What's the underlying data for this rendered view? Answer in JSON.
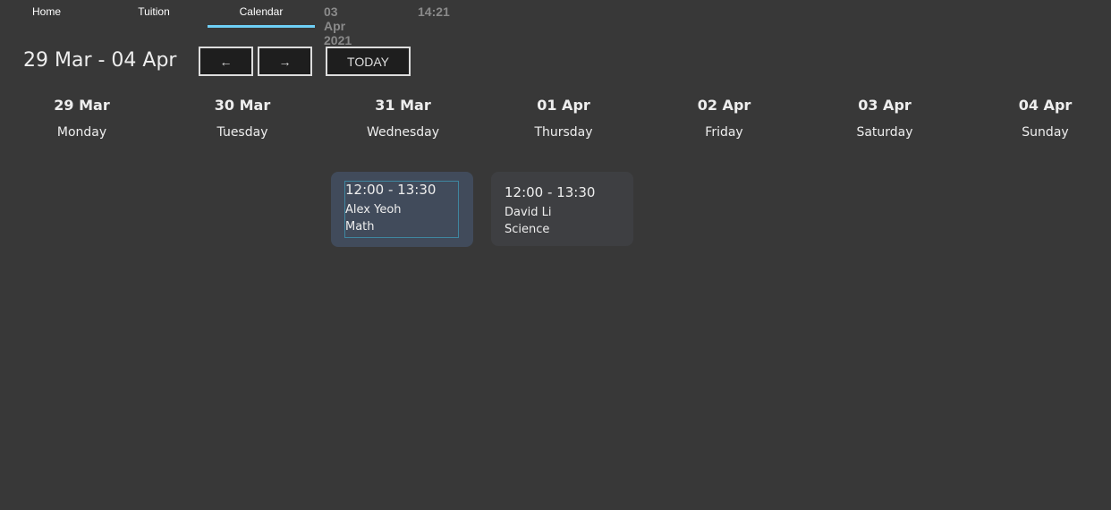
{
  "nav": {
    "tabs": [
      {
        "label": "Home"
      },
      {
        "label": "Tuition"
      },
      {
        "label": "Calendar"
      }
    ],
    "date": "03 Apr 2021",
    "time": "14:21"
  },
  "header": {
    "range": "29 Mar - 04 Apr",
    "prev": "←",
    "next": "→",
    "today": "TODAY"
  },
  "days": [
    {
      "date": "29 Mar",
      "dow": "Monday"
    },
    {
      "date": "30 Mar",
      "dow": "Tuesday"
    },
    {
      "date": "31 Mar",
      "dow": "Wednesday"
    },
    {
      "date": "01 Apr",
      "dow": "Thursday"
    },
    {
      "date": "02 Apr",
      "dow": "Friday"
    },
    {
      "date": "03 Apr",
      "dow": "Saturday"
    },
    {
      "date": "04 Apr",
      "dow": "Sunday"
    }
  ],
  "events": [
    {
      "time": "12:00 - 13:30",
      "tutor": "Alex Yeoh",
      "subject": "Math",
      "day": "31 Mar"
    },
    {
      "time": "12:00 - 13:30",
      "tutor": "David Li",
      "subject": "Science",
      "day": "01 Apr"
    }
  ]
}
